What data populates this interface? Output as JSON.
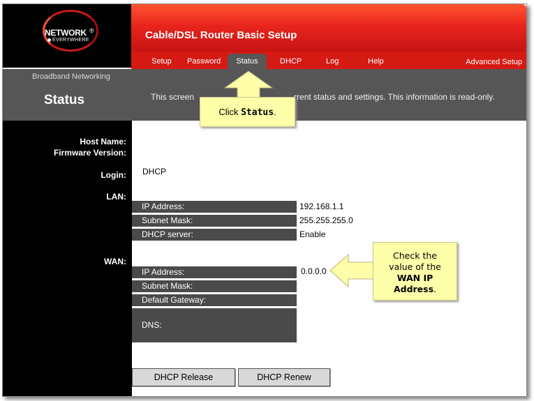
{
  "logo": {
    "main": "NETWORK",
    "sub": "EVERYWHERE",
    "reg": "®"
  },
  "app_title": "Cable/DSL Router Basic Setup",
  "tabs": [
    {
      "label": "Setup"
    },
    {
      "label": "Password"
    },
    {
      "label": "Status"
    },
    {
      "label": "DHCP"
    },
    {
      "label": "Log"
    },
    {
      "label": "Help"
    }
  ],
  "advanced_setup": "Advanced Setup",
  "section_label": "Broadband Networking",
  "page_title": "Status",
  "description_start": "This screen",
  "description_end": "rrent status and settings. This information is read-only.",
  "fields": {
    "host_name": "Host Name:",
    "firmware_version": "Firmware Version:",
    "login": "Login:",
    "login_value": "DHCP",
    "lan": "LAN:",
    "wan": "WAN:"
  },
  "lan_rows": [
    {
      "label": "IP Address:",
      "value": "192.168.1.1"
    },
    {
      "label": "Subnet Mask:",
      "value": "255.255.255.0"
    },
    {
      "label": "DHCP server:",
      "value": "Enable"
    }
  ],
  "wan_rows": [
    {
      "label": "IP Address:",
      "value": "0.0.0.0"
    },
    {
      "label": "Subnet Mask:",
      "value": ""
    },
    {
      "label": "Default Gateway:",
      "value": ""
    },
    {
      "label": "DNS:",
      "value": ""
    }
  ],
  "buttons": {
    "release": "DHCP Release",
    "renew": "DHCP Renew"
  },
  "callout_status": {
    "prefix": "Click ",
    "bold": "Status",
    "suffix": "."
  },
  "callout_wan": {
    "line1": "Check the",
    "line2": "value of the",
    "line3": "WAN IP",
    "line4": "Address",
    "suffix": "."
  },
  "colors": {
    "brand_red": "#e8251d",
    "callout": "#ffffaa",
    "panel_grey": "#565656"
  }
}
